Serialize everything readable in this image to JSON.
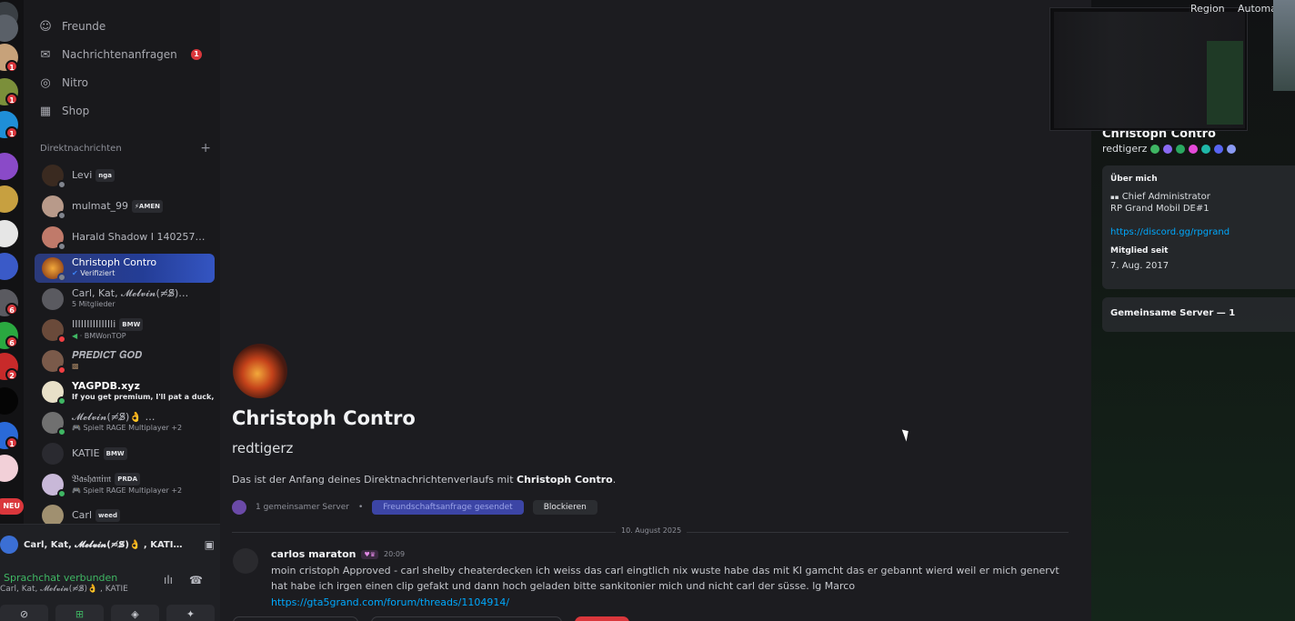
{
  "rail": {
    "badges": [
      "1",
      "1",
      "1",
      "6",
      "6",
      "2",
      "1"
    ],
    "new_label": "NEU"
  },
  "nav": {
    "friends": "Freunde",
    "requests": "Nachrichtenanfragen",
    "requests_badge": "1",
    "nitro": "Nitro",
    "shop": "Shop"
  },
  "dm_section": {
    "title": "Direktnachrichten",
    "add": "+"
  },
  "dms": [
    {
      "name": "Levi",
      "tag": "nga",
      "sub": ""
    },
    {
      "name": "mulmat_99",
      "tag": "⚡AMEN",
      "sub": ""
    },
    {
      "name": "Harald Shadow I 140257…",
      "tag": "",
      "sub": ""
    },
    {
      "name": "Christoph Contro",
      "tag": "",
      "sub": "Verifiziert"
    },
    {
      "name": "Carl, Kat, 𝓜𝓮𝓵𝓿𝓲𝓷(≂̸S̸̷)…",
      "tag": "",
      "sub": "5 Mitglieder"
    },
    {
      "name": "IIIIIIIIIIIIIli",
      "tag": "BMW",
      "sub": "· BMWonTOP"
    },
    {
      "name": "𝑷𝑹𝑬𝑫𝑰𝑪𝑻 𝑮𝑶𝑫",
      "tag": "",
      "sub": ""
    },
    {
      "name": "YAGPDB.xyz",
      "tag": "",
      "sub": "If you get premium, I'll pat a duck, …"
    },
    {
      "name": "𝓜𝓮𝓵𝓿𝓲𝓷(≂̸S̸̷)👌 …",
      "tag": "",
      "sub": "Spielt RAGE Multiplayer +2"
    },
    {
      "name": "KATIE",
      "tag": "BMW",
      "sub": ""
    },
    {
      "name": "𝔅𝔞𝔰𝔥𝔞𝔫𝔦𝔪",
      "tag": "PRDA",
      "sub": "Spielt RAGE Multiplayer +2"
    },
    {
      "name": "Carl",
      "tag": "weed",
      "sub": ""
    }
  ],
  "call": {
    "title": "Carl, Kat, 𝓜𝓮𝓵𝓿𝓲𝓷(≂̸S̸̷)👌 , KATI…",
    "status": "Sprachchat verbunden",
    "members": "Carl, Kat, 𝓜𝓮𝓵𝓿𝓲𝓷(≂̸S̸̷)👌 , KATIE"
  },
  "profile": {
    "display_name": "Christoph Contro",
    "username": "redtigerz",
    "intro_prefix": "Das ist der Anfang deines Direktnachrichtenverlaufs mit ",
    "intro_name": "Christoph Contro",
    "intro_suffix": ".",
    "mutual": "1 gemeinsamer Server",
    "friend_btn": "Freundschaftsanfrage gesendet",
    "block_btn": "Blockieren"
  },
  "date_divider": "10. August 2025",
  "message": {
    "author": "carlos maraton",
    "time": "20:09",
    "text": "moin cristoph Approved - carl shelby cheaterdecken ich weiss das carl eingtlich nix wuste habe das mit KI gamcht das er gebannt wierd weil er mich genervt hat habe ich irgen einen clip gefakt und dann hoch geladen bitte sankitonier mich und nicht carl der süsse. lg Marco",
    "link": "https://gta5grand.com/forum/threads/1104914/"
  },
  "right_panel": {
    "name": "Christoph Contro",
    "username": "redtigerz",
    "about_label": "Über mich",
    "about_line1": "Chief Administrator",
    "about_line2": "RP Grand Mobil DE#1",
    "about_link": "https://discord.gg/rpgrand",
    "member_since_label": "Mitglied seit",
    "member_since": "7. Aug. 2017",
    "mutual_servers": "Gemeinsame Server — 1"
  },
  "overlay": {
    "region": "Region",
    "automation": "Automati"
  }
}
